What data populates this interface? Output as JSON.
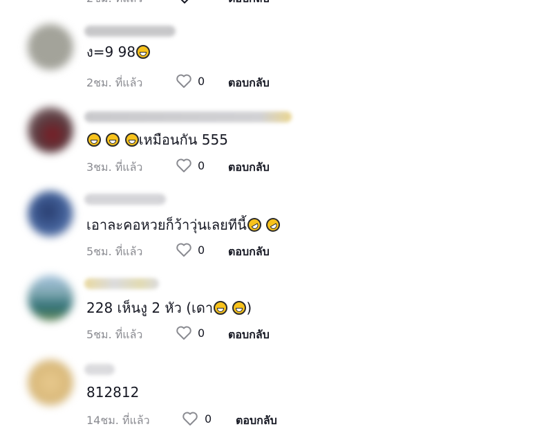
{
  "comments": [
    {
      "text": "ง=9 98",
      "emojis": [
        "grinning-sweat-icon"
      ],
      "time": "2ชม. ที่แล้ว",
      "likes": "0",
      "reply": "ตอบกลับ"
    },
    {
      "text": "เหมือนกัน 555",
      "emojis": [
        "grinning-sweat-icon",
        "grinning-sweat-icon",
        "grinning-sweat-icon"
      ],
      "time": "3ชม. ที่แล้ว",
      "likes": "0",
      "reply": "ตอบกลับ"
    },
    {
      "text": "เอาละคอหวยก็ว้าวุ่นเลยทีนี้",
      "emojis": [
        "rofl-icon",
        "rofl-icon"
      ],
      "time": "5ชม. ที่แล้ว",
      "likes": "0",
      "reply": "ตอบกลับ"
    },
    {
      "text": "228 เห็นงู 2 หัว (เดา",
      "text_end": ")",
      "emojis": [
        "grinning-sweat-icon",
        "grinning-sweat-icon"
      ],
      "time": "5ชม. ที่แล้ว",
      "likes": "0",
      "reply": "ตอบกลับ"
    },
    {
      "text": "812812",
      "emojis": [],
      "time": "14ชม. ที่แล้ว",
      "likes": "0",
      "reply": "ตอบกลับ"
    }
  ],
  "colors": {
    "emoji": "#f7c21c",
    "meta_text": "#8a8b91",
    "primary_text": "#161823"
  }
}
